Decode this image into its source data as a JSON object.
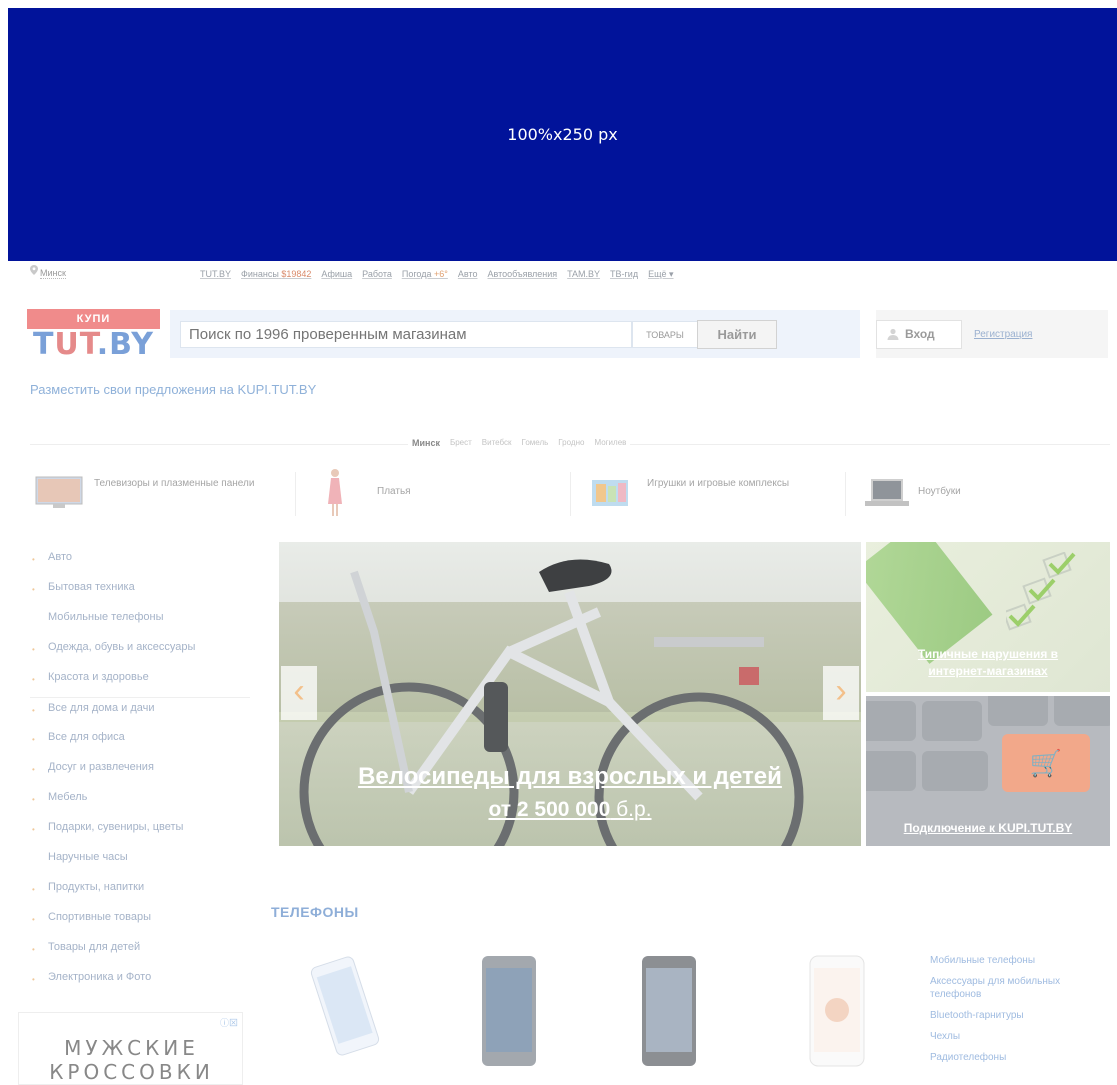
{
  "banner": {
    "text": "100%x250 px"
  },
  "topnav": {
    "city": "Минск",
    "links": [
      "TUT.BY",
      "Финансы",
      "Афиша",
      "Работа",
      "Погода",
      "Авто",
      "Автообъявления",
      "TAM.BY",
      "ТВ-гид",
      "Ещё"
    ],
    "finance_value": "$19842",
    "weather_value": "+6°",
    "more_arrow": "▾"
  },
  "header": {
    "logo_top": "КУПИ",
    "logo_bottom_t1": "T",
    "logo_bottom_ut": "UT",
    "logo_bottom_rest": ".BY",
    "search_placeholder": "Поиск по 1996 проверенным магазинам",
    "search_category": "ТОВАРЫ",
    "search_button": "Найти",
    "login": "Вход",
    "register": "Регистрация"
  },
  "place_offers": "Разместить свои предложения на KUPI.TUT.BY",
  "cities": {
    "active": "Минск",
    "others": [
      "Брест",
      "Витебск",
      "Гомель",
      "Гродно",
      "Могилев"
    ]
  },
  "categories": [
    {
      "label": "Телевизоры и плазменные панели"
    },
    {
      "label": "Платья"
    },
    {
      "label": "Игрушки и игровые комплексы"
    },
    {
      "label": "Ноутбуки"
    }
  ],
  "sidebar": {
    "items": [
      {
        "label": "Авто",
        "bullet": true
      },
      {
        "label": "Бытовая техника",
        "bullet": true
      },
      {
        "label": "Мобильные телефоны",
        "bullet": false
      },
      {
        "label": "Одежда, обувь и аксессуары",
        "bullet": true
      },
      {
        "label": "Красота и здоровье",
        "bullet": true
      },
      {
        "label": "Все для дома и дачи",
        "bullet": true
      },
      {
        "label": "Все для офиса",
        "bullet": true
      },
      {
        "label": "Досуг и развлечения",
        "bullet": true
      },
      {
        "label": "Мебель",
        "bullet": true
      },
      {
        "label": "Подарки, сувениры, цветы",
        "bullet": true
      },
      {
        "label": "Наручные часы",
        "bullet": false
      },
      {
        "label": "Продукты, напитки",
        "bullet": true
      },
      {
        "label": "Спортивные товары",
        "bullet": true
      },
      {
        "label": "Товары для детей",
        "bullet": true
      },
      {
        "label": "Электроника и Фото",
        "bullet": true
      }
    ],
    "bullet_char": "•"
  },
  "ad": {
    "line1": "МУЖСКИЕ",
    "line2": "КРОССОВКИ",
    "mark": "ⓘ⊠"
  },
  "slider": {
    "title": "Велосипеды для взрослых и детей",
    "price_prefix": "от 2 500 000",
    "price_currency": " б.р.",
    "prev": "‹",
    "next": "›"
  },
  "promos": [
    {
      "line1": "Типичные нарушения в",
      "line2": "интернет-магазинах"
    },
    {
      "text": "Подключение к KUPI.TUT.BY",
      "cart": "🛒"
    }
  ],
  "phones": {
    "title": "ТЕЛЕФОНЫ",
    "links": [
      "Мобильные телефоны",
      "Аксессуары для мобильных телефонов",
      "Bluetooth-гарнитуры",
      "Чехлы",
      "Радиотелефоны"
    ]
  },
  "colors": {
    "banner": "#01139a",
    "link": "#8fb1d9",
    "accent": "#f08b8b"
  }
}
